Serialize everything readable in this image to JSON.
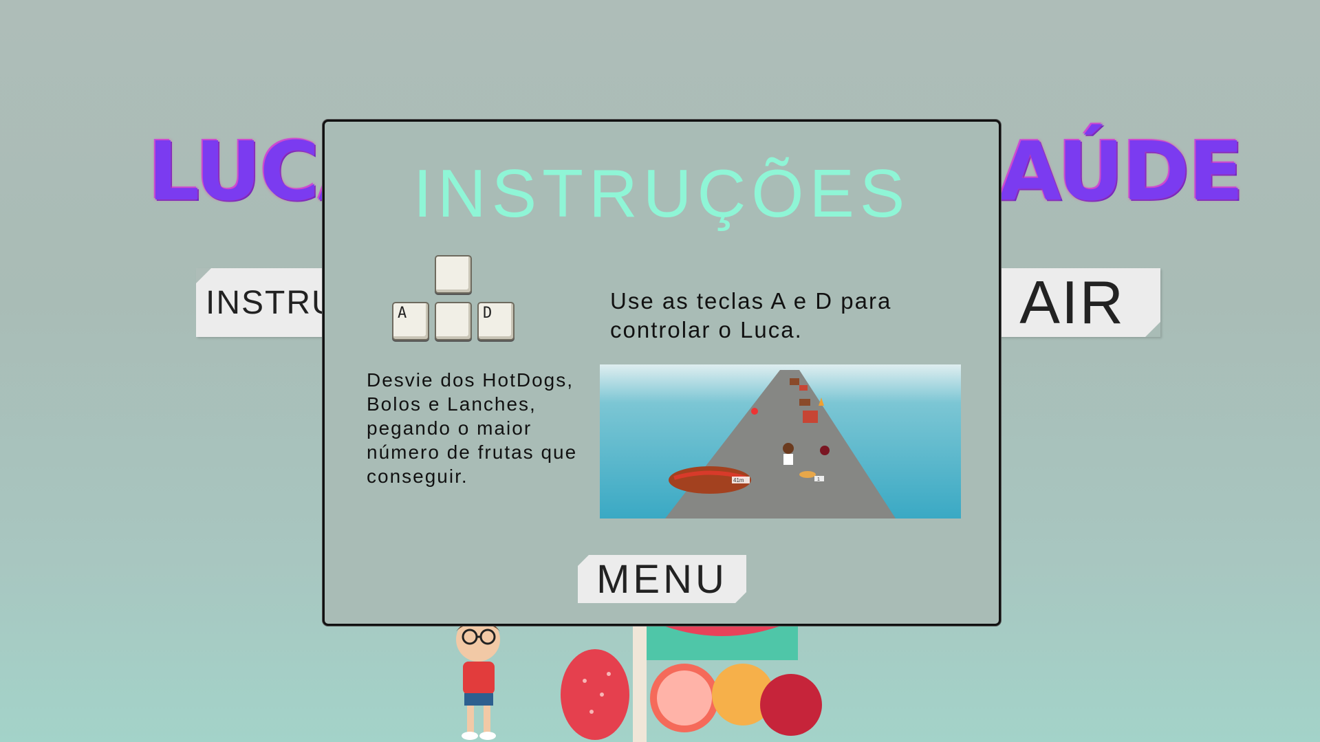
{
  "background": {
    "title_left": "LUCA",
    "title_right": "AÚDE",
    "button_instructions_partial": "INSTRU",
    "button_exit_partial": "AIR"
  },
  "modal": {
    "title": "INSTRUÇÕES",
    "keys": [
      "A",
      "",
      "D"
    ],
    "controls_text": "Use as teclas A e D para controlar o Luca.",
    "goal_text": "Desvie dos HotDogs, Bolos e Lanches, pegando o maior número de frutas que conseguir.",
    "preview_distance": "41m",
    "preview_score": "1",
    "menu_button": "MENU"
  },
  "colors": {
    "title_accent": "#8ff5d6",
    "logo": "#7b3bf0",
    "panel": "#a9bcb6"
  }
}
